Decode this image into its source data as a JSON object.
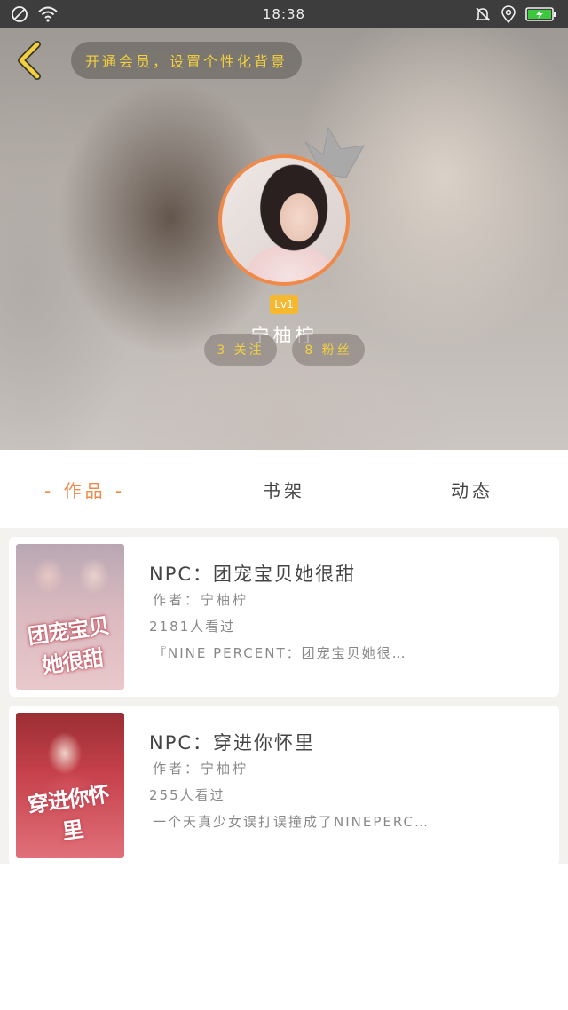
{
  "status_bar": {
    "time": "18:38",
    "icons_left": [
      "no-sim-icon",
      "wifi-icon"
    ],
    "icons_right": [
      "mute-bell-icon",
      "location-icon",
      "battery-icon"
    ]
  },
  "header": {
    "vip_banner": "开通会员，设置个性化背景",
    "level": "Lv1",
    "username": "宁柚柠",
    "following": "3 关注",
    "fans": "8 粉丝"
  },
  "tabs": {
    "works": "- 作品 -",
    "shelf": "书架",
    "feed": "动态",
    "active": "works"
  },
  "books": [
    {
      "title": "NPC：团宠宝贝她很甜",
      "author": "作者：宁柚柠",
      "views": "2181人看过",
      "desc": "『NINE PERCENT：团宠宝贝她很…",
      "cover_text": "团宠宝贝她很甜"
    },
    {
      "title": "NPC：穿进你怀里",
      "author": "作者：宁柚柠",
      "views": "255人看过",
      "desc": "一个天真少女误打误撞成了NINEPERC…",
      "cover_text": "穿进你怀里"
    }
  ],
  "colors": {
    "accent": "#f08a4b",
    "gold": "#f4d03f",
    "status_bar": "#3d3d3d"
  }
}
